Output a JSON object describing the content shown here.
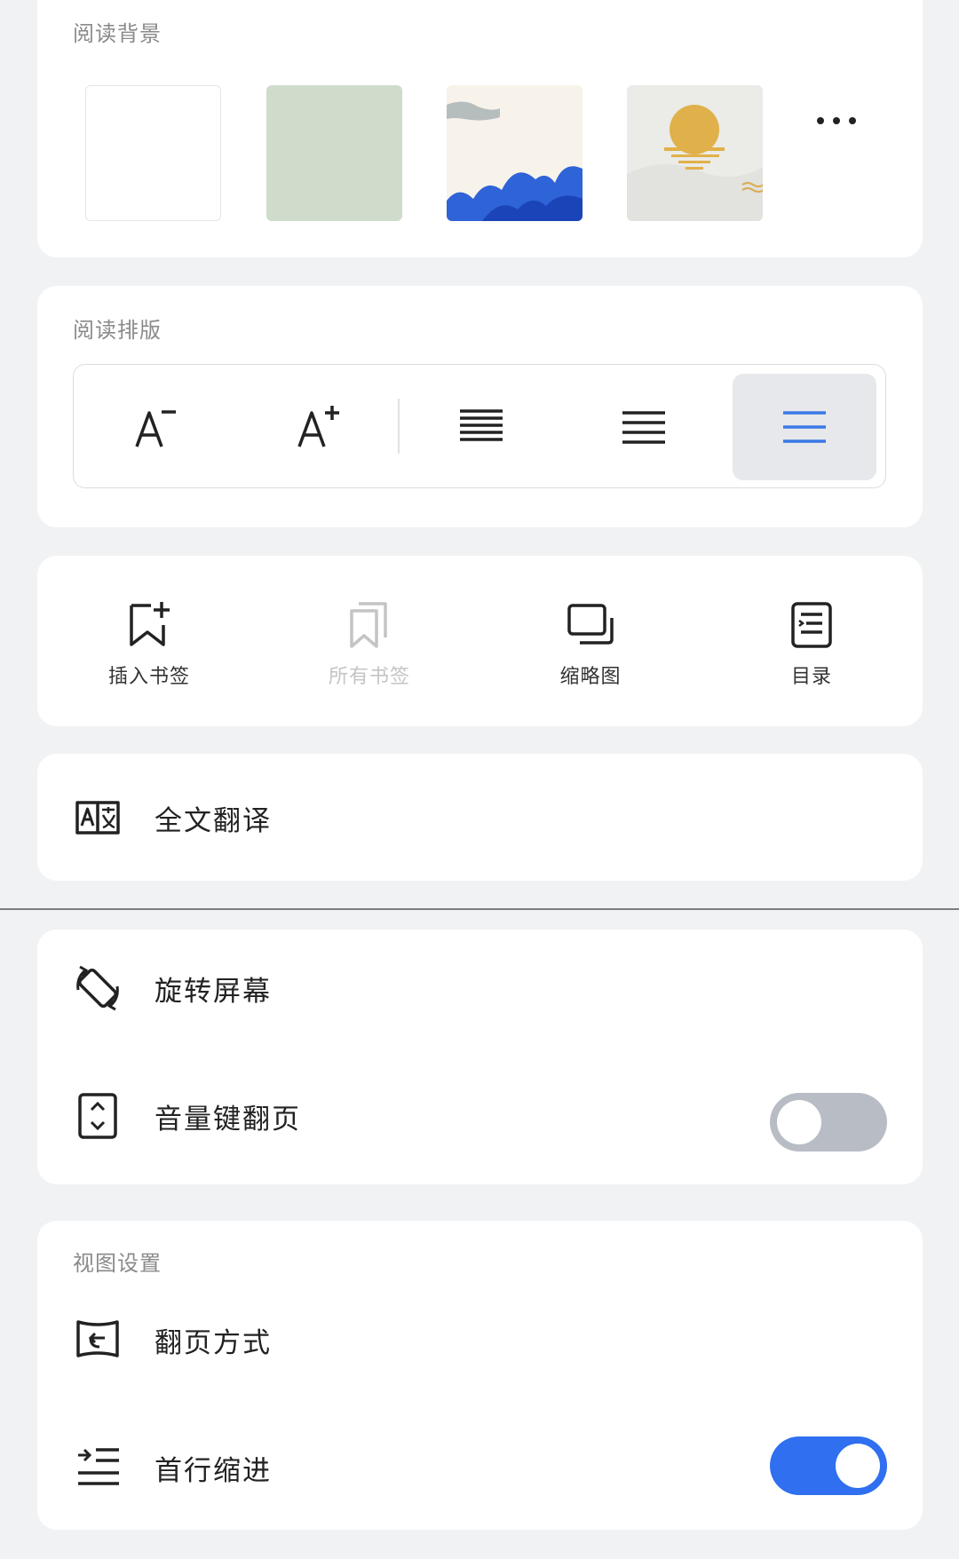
{
  "reading_background": {
    "title": "阅读背景",
    "options": [
      "white",
      "green",
      "blue-waves",
      "golden-sun"
    ]
  },
  "reading_layout": {
    "title": "阅读排版",
    "buttons": [
      "font-size-decrease-icon",
      "font-size-increase-icon",
      "line-spacing-compact-icon",
      "line-spacing-medium-icon",
      "line-spacing-loose-icon"
    ],
    "active_index": 4,
    "accent_color": "#3a78e6"
  },
  "actions": {
    "insert_bookmark": "插入书签",
    "all_bookmarks": "所有书签",
    "thumbnail": "缩略图",
    "toc": "目录"
  },
  "translate": {
    "label": "全文翻译"
  },
  "screen": {
    "rotate_label": "旋转屏幕",
    "volume_key_label": "音量键翻页",
    "volume_key_on": false
  },
  "view_settings": {
    "title": "视图设置",
    "page_turn_label": "翻页方式",
    "indent_label": "首行缩进",
    "indent_on": true
  },
  "colors": {
    "toggle_on": "#2f6ff0",
    "toggle_off": "#b8bcc5"
  }
}
